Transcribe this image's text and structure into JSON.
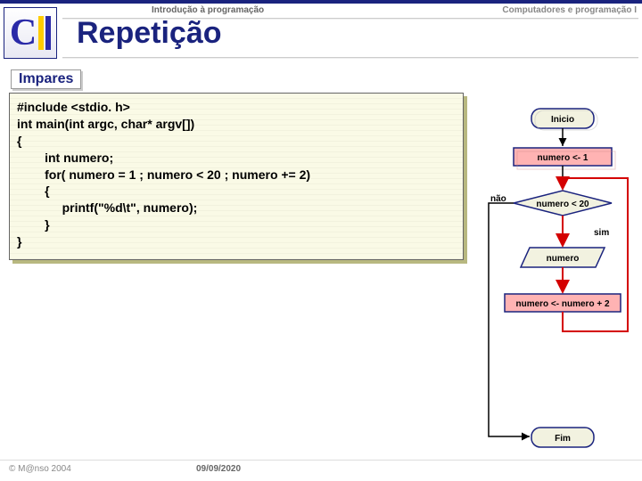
{
  "header": {
    "left": "Introdução à programação",
    "right": "Computadores e programação I",
    "title": "Repetição"
  },
  "section": {
    "label": "Impares"
  },
  "code": {
    "text": "#include <stdio. h>\nint main(int argc, char* argv[])\n{\n        int numero;\n        for( numero = 1 ; numero < 20 ; numero += 2)\n        {\n             printf(\"%d\\t\", numero);\n        }\n}"
  },
  "flow": {
    "start": "Inicio",
    "init": "numero <- 1",
    "cond": "numero < 20",
    "no": "não",
    "yes": "sim",
    "print": "numero",
    "incr": "numero <- numero + 2",
    "end": "Fim"
  },
  "footer": {
    "copyright": "© M@nso 2004",
    "date": "09/09/2020"
  }
}
